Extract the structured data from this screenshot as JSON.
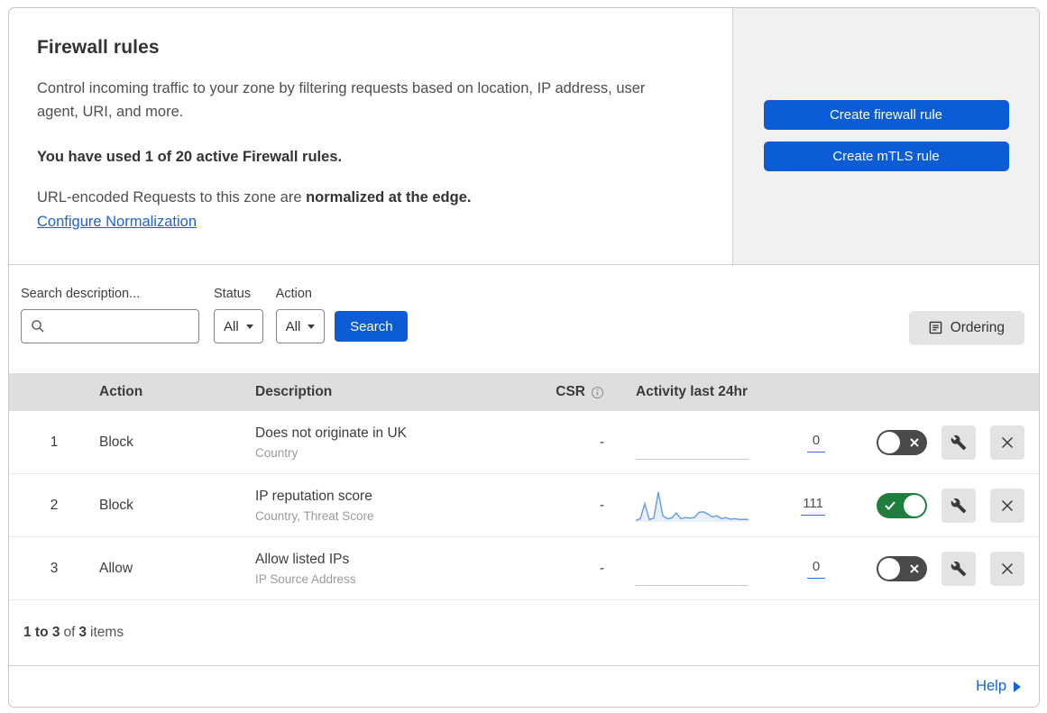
{
  "header": {
    "title": "Firewall rules",
    "description": "Control incoming traffic to your zone by filtering requests based on location, IP address, user agent, URI, and more.",
    "usage_text": "You have used 1 of 20 active Firewall rules.",
    "normalization_prefix": "URL-encoded Requests to this zone are ",
    "normalization_bold": "normalized at the edge.",
    "normalization_link": "Configure Normalization",
    "create_firewall_button": "Create firewall rule",
    "create_mtls_button": "Create mTLS rule"
  },
  "filters": {
    "search_label": "Search description...",
    "search_value": "",
    "status_label": "Status",
    "status_value": "All",
    "action_label": "Action",
    "action_value": "All",
    "search_button": "Search",
    "ordering_button": "Ordering"
  },
  "table": {
    "columns": {
      "action": "Action",
      "description": "Description",
      "csr": "CSR",
      "activity": "Activity last 24hr"
    },
    "rows": [
      {
        "index": "1",
        "action": "Block",
        "description": "Does not originate in UK",
        "fields": "Country",
        "csr": "-",
        "activity_count": "0",
        "enabled": false,
        "sparkline": []
      },
      {
        "index": "2",
        "action": "Block",
        "description": "IP reputation score",
        "fields": "Country, Threat Score",
        "csr": "-",
        "activity_count": "111",
        "enabled": true,
        "sparkline": [
          2,
          8,
          60,
          5,
          10,
          100,
          18,
          8,
          10,
          28,
          8,
          12,
          10,
          12,
          30,
          32,
          24,
          14,
          18,
          8,
          12,
          6,
          8,
          5,
          6,
          5
        ]
      },
      {
        "index": "3",
        "action": "Allow",
        "description": "Allow listed IPs",
        "fields": "IP Source Address",
        "csr": "-",
        "activity_count": "0",
        "enabled": false,
        "sparkline": []
      }
    ],
    "summary": {
      "range": "1 to 3",
      "of_label": "of",
      "total": "3",
      "items_label": "items"
    }
  },
  "footer": {
    "help_label": "Help"
  },
  "colors": {
    "accent_blue": "#0b5cd5",
    "link_blue": "#1f62d3",
    "toggle_on_green": "#1f7e3e",
    "toggle_off_gray": "#4a4a4a",
    "spark_line": "#6d9fe0",
    "spark_fill": "#e9effb",
    "table_header_gray": "#dedede",
    "side_panel_gray": "#f1f1f1",
    "count_underline_blue": "#2f6fd6"
  }
}
